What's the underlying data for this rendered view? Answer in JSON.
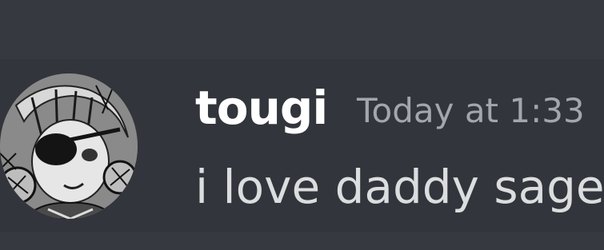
{
  "message": {
    "author": "tougi",
    "timestamp": "Today at 1:33",
    "text": "i love daddy sage"
  },
  "colors": {
    "background": "#36393f",
    "message_hover_background": "#32353b",
    "username": "#ffffff",
    "timestamp": "#a3a6aa",
    "text": "#dcddde"
  }
}
